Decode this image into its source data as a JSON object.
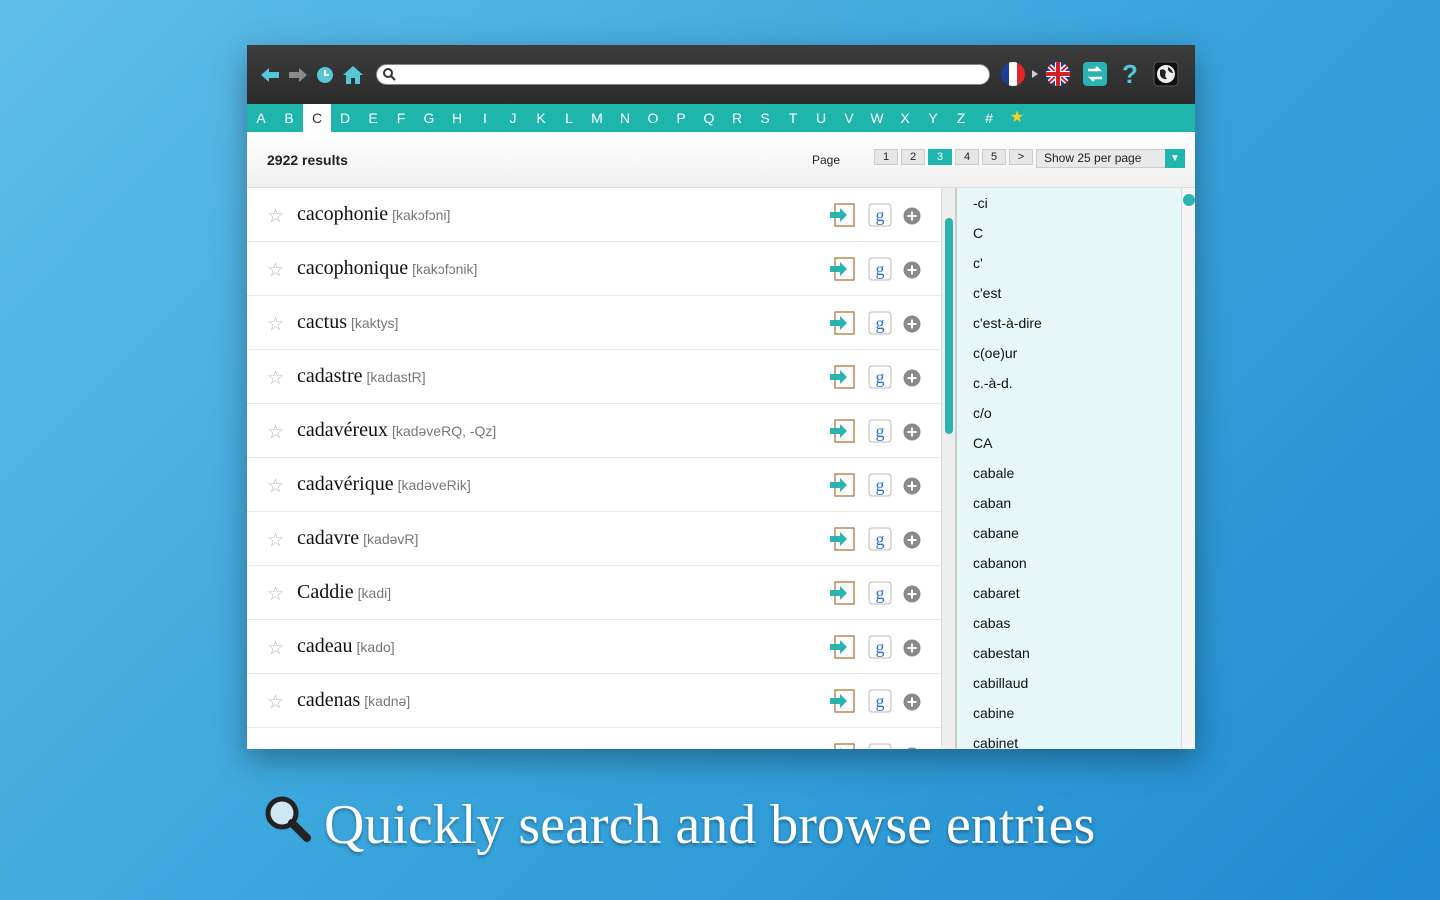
{
  "toolbar": {
    "search_placeholder": "",
    "icons": [
      "back-arrow-icon",
      "forward-arrow-icon",
      "history-icon",
      "home-icon",
      "french-flag-icon",
      "uk-flag-icon",
      "swap-icon",
      "help-icon",
      "globe-icon"
    ]
  },
  "alphabet": [
    "A",
    "B",
    "C",
    "D",
    "E",
    "F",
    "G",
    "H",
    "I",
    "J",
    "K",
    "L",
    "M",
    "N",
    "O",
    "P",
    "Q",
    "R",
    "S",
    "T",
    "U",
    "V",
    "W",
    "X",
    "Y",
    "Z",
    "#"
  ],
  "active_letter": "C",
  "results": {
    "count": "2922 results",
    "page_label": "Page",
    "pages": [
      "1",
      "2",
      "3",
      "4",
      "5",
      ">"
    ],
    "active_page": "3",
    "per_page": "Show 25 per page"
  },
  "entries": [
    {
      "word": "cacophonie",
      "phonetic": "[kakɔfɔni]"
    },
    {
      "word": "cacophonique",
      "phonetic": "[kakɔfɔnik]"
    },
    {
      "word": "cactus",
      "phonetic": "[kaktys]"
    },
    {
      "word": "cadastre",
      "phonetic": "[kadastR]"
    },
    {
      "word": "cadavéreux",
      "phonetic": "[kadəveRQ, -Qz]"
    },
    {
      "word": "cadavérique",
      "phonetic": "[kadəveRik]"
    },
    {
      "word": "cadavre",
      "phonetic": "[kadəvR]"
    },
    {
      "word": "Caddie",
      "phonetic": "[kadi]"
    },
    {
      "word": "cadeau",
      "phonetic": "[kado]"
    },
    {
      "word": "cadenas",
      "phonetic": "[kadnə]"
    }
  ],
  "sidebar": [
    "-ci",
    "C",
    "c'",
    "c'est",
    "c'est-à-dire",
    "c(oe)ur",
    "c.-à-d.",
    "c/o",
    "CA",
    "cabale",
    "caban",
    "cabane",
    "cabanon",
    "cabaret",
    "cabas",
    "cabestan",
    "cabillaud",
    "cabine",
    "cabinet"
  ],
  "tagline": "Quickly search and browse entries",
  "colors": {
    "accent": "#1eb5ad",
    "toolbar": "#333333",
    "sidebar_bg": "#e5f7f7"
  }
}
